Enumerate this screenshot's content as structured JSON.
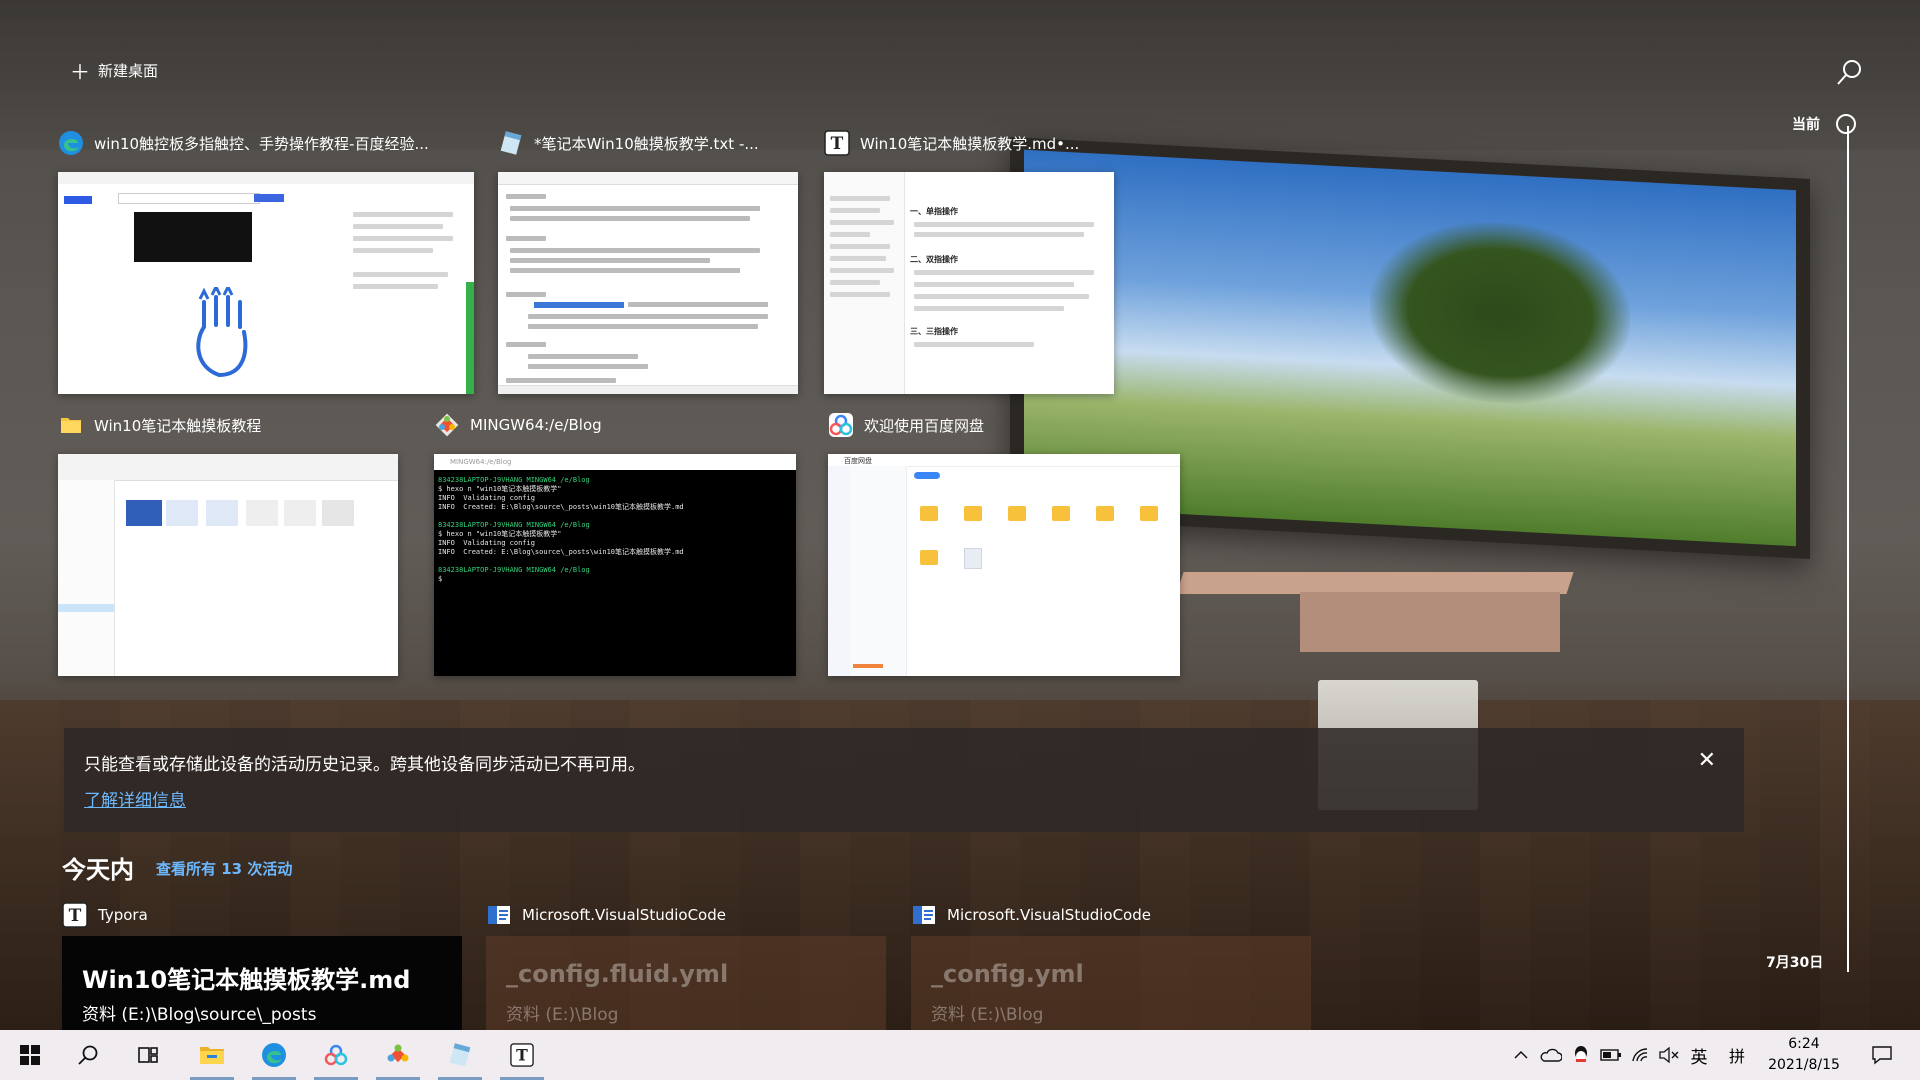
{
  "header": {
    "new_desktop_label": "新建桌面",
    "search_icon": "search-icon"
  },
  "windows": [
    {
      "title": "win10触控板多指触控、手势操作教程-百度经验...",
      "icon": "edge-icon",
      "thumb": "browser"
    },
    {
      "title": "*笔记本Win10触摸板教学.txt -...",
      "icon": "notepad-icon",
      "thumb": "notepad"
    },
    {
      "title": "Win10笔记本触摸板教学.md•...",
      "icon": "typora-icon",
      "thumb": "typora",
      "sections": [
        "一、单指操作",
        "二、双指操作",
        "三、三指操作"
      ]
    },
    {
      "title": "Win10笔记本触摸板教程",
      "icon": "folder-icon",
      "thumb": "explorer"
    },
    {
      "title": "MINGW64:/e/Blog",
      "icon": "git-icon",
      "thumb": "terminal",
      "window_title": "MINGW64:/e/Blog",
      "lines": [
        {
          "text": "834238LAPTOP-J9VHANG MINGW64 /e/Blog",
          "color": "g"
        },
        {
          "text": "$ hexo n \"win10笔记本触摸板教学\"",
          "color": ""
        },
        {
          "text": "INFO  Validating config",
          "color": ""
        },
        {
          "text": "INFO  Created: E:\\Blog\\source\\_posts\\win10笔记本触摸板教学.md",
          "color": ""
        },
        {
          "text": "",
          "color": ""
        },
        {
          "text": "834238LAPTOP-J9VHANG MINGW64 /e/Blog",
          "color": "g"
        },
        {
          "text": "$ hexo n \"win10笔记本触摸板教学\"",
          "color": ""
        },
        {
          "text": "INFO  Validating config",
          "color": ""
        },
        {
          "text": "INFO  Created: E:\\Blog\\source\\_posts\\win10笔记本触摸板教学.md",
          "color": ""
        },
        {
          "text": "",
          "color": ""
        },
        {
          "text": "834238LAPTOP-J9VHANG MINGW64 /e/Blog",
          "color": "g"
        },
        {
          "text": "$",
          "color": ""
        }
      ]
    },
    {
      "title": "欢迎使用百度网盘",
      "icon": "baidu-netdisk-icon",
      "thumb": "netdisk",
      "app_name": "百度网盘"
    }
  ],
  "notice": {
    "message": "只能查看或存储此设备的活动历史记录。跨其他设备同步活动已不再可用。",
    "link": "了解详细信息",
    "close_icon": "close-icon"
  },
  "today": {
    "label": "今天内",
    "see_all": "查看所有 13 次活动"
  },
  "activities": [
    {
      "app": "Typora",
      "icon": "typora-icon",
      "title": "Win10笔记本触摸板教学.md",
      "subtitle": "资料 (E:)\\Blog\\source\\_posts",
      "style": "dark"
    },
    {
      "app": "Microsoft.VisualStudioCode",
      "icon": "vscode-icon",
      "title": "_config.fluid.yml",
      "subtitle": "资料 (E:)\\Blog",
      "style": "dim"
    },
    {
      "app": "Microsoft.VisualStudioCode",
      "icon": "vscode-icon",
      "title": "_config.yml",
      "subtitle": "资料 (E:)\\Blog",
      "style": "dim"
    }
  ],
  "timeline": {
    "current_label": "当前",
    "date_label": "7月30日"
  },
  "taskbar": {
    "items": [
      "start-icon",
      "search-icon",
      "task-view-icon",
      "file-explorer-icon",
      "edge-icon",
      "baidu-netdisk-icon",
      "git-icon",
      "notepad-icon",
      "typora-icon"
    ],
    "tray": {
      "ime_lang": "英",
      "ime_mode": "拼",
      "time": "6:24",
      "date": "2021/8/15"
    }
  }
}
